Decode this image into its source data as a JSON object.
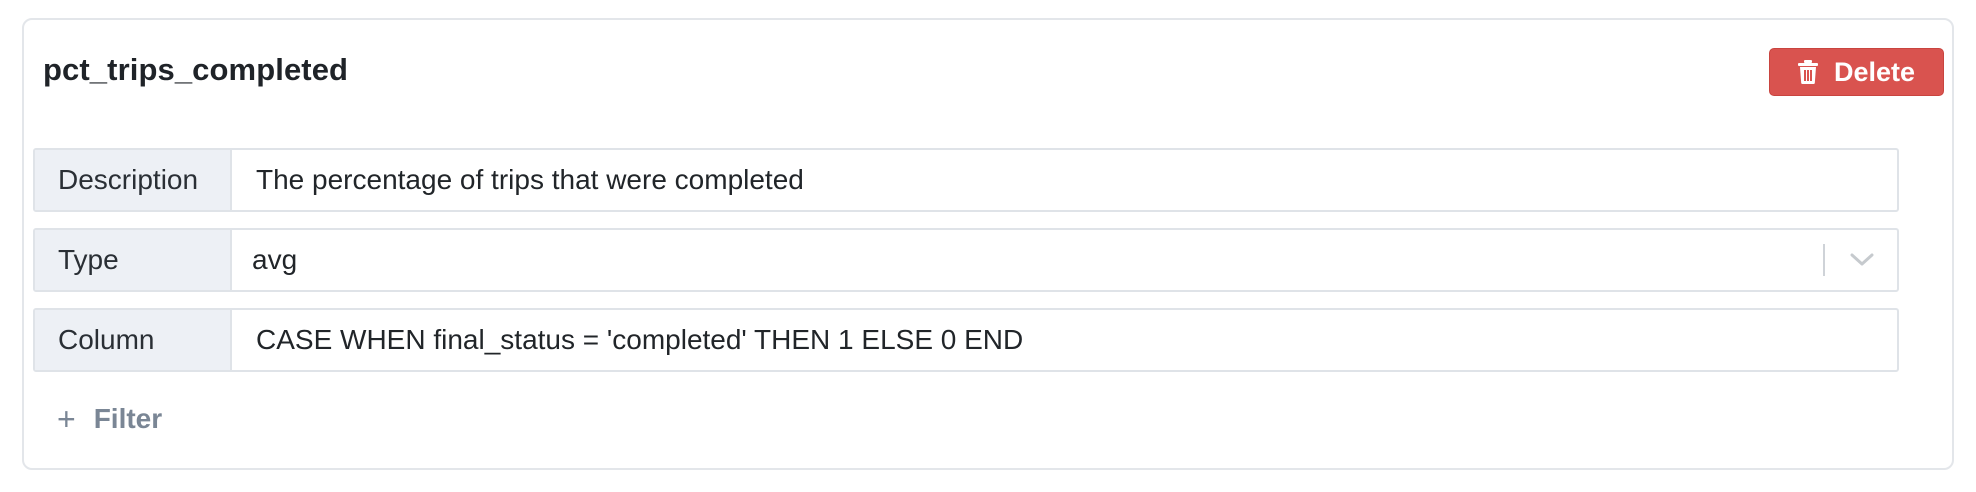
{
  "metric": {
    "title": "pct_trips_completed",
    "delete_label": "Delete"
  },
  "fields": {
    "description": {
      "label": "Description",
      "value": "The percentage of trips that were completed"
    },
    "type": {
      "label": "Type",
      "value": "avg"
    },
    "column": {
      "label": "Column",
      "value": "CASE WHEN final_status = 'completed' THEN 1 ELSE 0 END"
    }
  },
  "filter": {
    "plus_symbol": "+",
    "label": "Filter"
  },
  "icons": {
    "delete": "trash-icon",
    "select": "chevron-down-icon",
    "filter": "plus-icon"
  },
  "colors": {
    "danger": "#d9534f",
    "label_bg": "#edf0f5",
    "muted_link": "#7a8695"
  }
}
